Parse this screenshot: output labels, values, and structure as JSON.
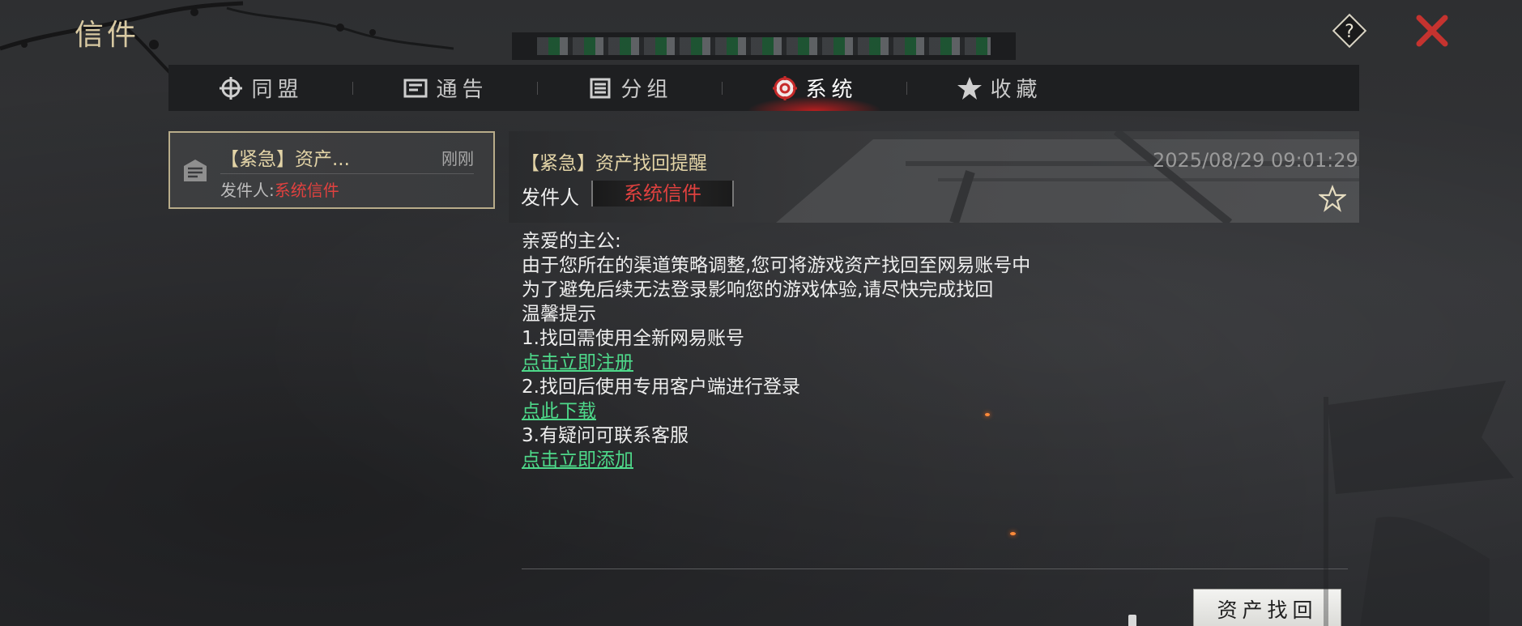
{
  "header": {
    "title": "信件"
  },
  "tabs": [
    {
      "label": "同盟",
      "icon": "alliance-icon"
    },
    {
      "label": "通告",
      "icon": "notice-icon"
    },
    {
      "label": "分组",
      "icon": "group-list-icon"
    },
    {
      "label": "系统",
      "icon": "system-gear-icon",
      "active": true
    },
    {
      "label": "收藏",
      "icon": "star-filled-icon"
    }
  ],
  "mail_list": [
    {
      "subject": "【紧急】资产...",
      "time": "刚刚",
      "from_label": "发件人:",
      "from": "系统信件"
    }
  ],
  "detail": {
    "subject": "【紧急】资产找回提醒",
    "date": "2025/08/29 09:01:29",
    "sender_label": "发件人",
    "sender": "系统信件",
    "body": [
      "亲爱的主公:",
      "由于您所在的渠道策略调整,您可将游戏资产找回至网易账号中",
      "为了避免后续无法登录影响您的游戏体验,请尽快完成找回",
      "温馨提示",
      "1.找回需使用全新网易账号",
      "2.找回后使用专用客户端进行登录",
      "3.有疑问可联系客服"
    ],
    "links": [
      "点击立即注册",
      "点此下载",
      "点击立即添加"
    ]
  },
  "footer": {
    "button_label": "资产找回"
  },
  "colors": {
    "accent_red": "#e0413f",
    "link_green": "#4ed98a",
    "title_gold": "#d8c9a2"
  }
}
